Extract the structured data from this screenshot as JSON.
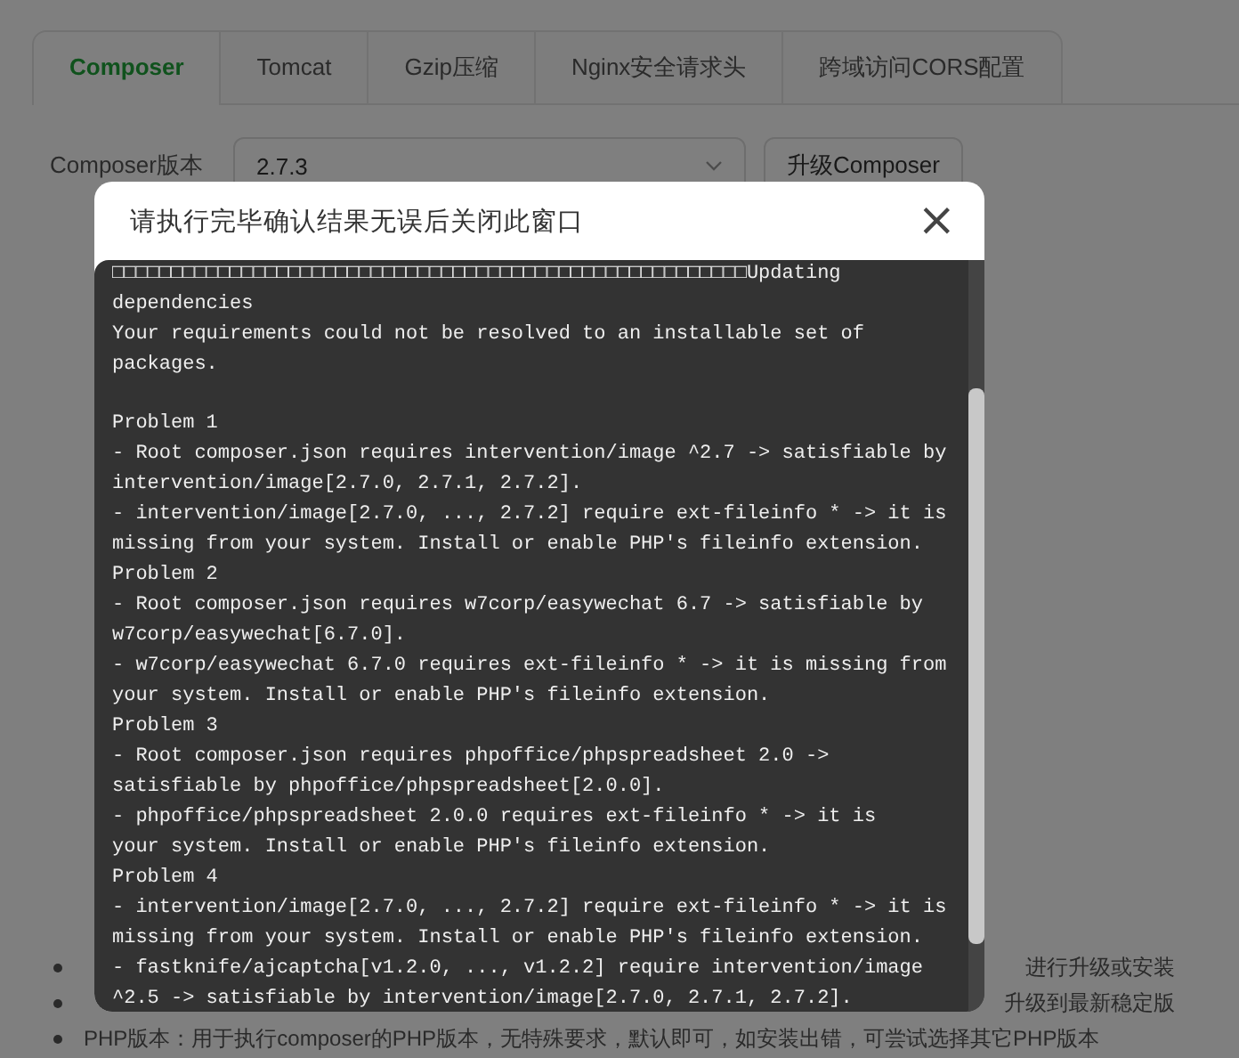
{
  "tabs": [
    {
      "label": "Composer",
      "selected": true
    },
    {
      "label": "Tomcat",
      "selected": false
    },
    {
      "label": "Gzip压缩",
      "selected": false
    },
    {
      "label": "Nginx安全请求头",
      "selected": false
    },
    {
      "label": "跨域访问CORS配置",
      "selected": false
    }
  ],
  "form": {
    "label": "Composer版本",
    "select_value": "2.7.3",
    "button": "升级Composer"
  },
  "notes": [
    {
      "visible_parts": [
        "进行升级或安装"
      ]
    },
    {
      "visible_parts": [
        "升级到最新稳定版"
      ]
    },
    {
      "visible_parts": [
        "PHP版本：用于执行composer的PHP版本，无特殊要求，默认即可，如安装出错，可尝试选择其它PHP版本"
      ]
    }
  ],
  "dialog": {
    "title": "请执行完毕确认结果无误后关闭此窗口",
    "close": "×",
    "output_blocks": [
      [
        "□□□□□□□□□□□□□□□□□□□□□□□□□□□□□□□□□□□□□□□□□□□□□□□□□□□□□□Updating",
        "dependencies",
        "Your requirements could not be resolved to an installable set of",
        "packages."
      ],
      [
        "Problem 1",
        "- Root composer.json requires intervention/image ^2.7 -> satisfiable by",
        "intervention/image[2.7.0, 2.7.1, 2.7.2].",
        "- intervention/image[2.7.0, ..., 2.7.2] require ext-fileinfo * -> it is",
        "missing from your system. Install or enable PHP's fileinfo extension.",
        "Problem 2",
        "- Root composer.json requires w7corp/easywechat 6.7 -> satisfiable by",
        "w7corp/easywechat[6.7.0].",
        "- w7corp/easywechat 6.7.0 requires ext-fileinfo * -> it is missing from",
        "your system. Install or enable PHP's fileinfo extension.",
        "Problem 3",
        "- Root composer.json requires phpoffice/phpspreadsheet 2.0 ->",
        "satisfiable by phpoffice/phpspreadsheet[2.0.0].",
        "- phpoffice/phpspreadsheet 2.0.0 requires ext-fileinfo * -> it is",
        "your system. Install or enable PHP's fileinfo extension.",
        "Problem 4",
        "- intervention/image[2.7.0, ..., 2.7.2] require ext-fileinfo * -> it is",
        "missing from your system. Install or enable PHP's fileinfo extension.",
        "- fastknife/ajcaptcha[v1.2.0, ..., v1.2.2] require intervention/image",
        "^2.5 -> satisfiable by intervention/image[2.7.0, 2.7.1, 2.7.2]."
      ]
    ]
  }
}
